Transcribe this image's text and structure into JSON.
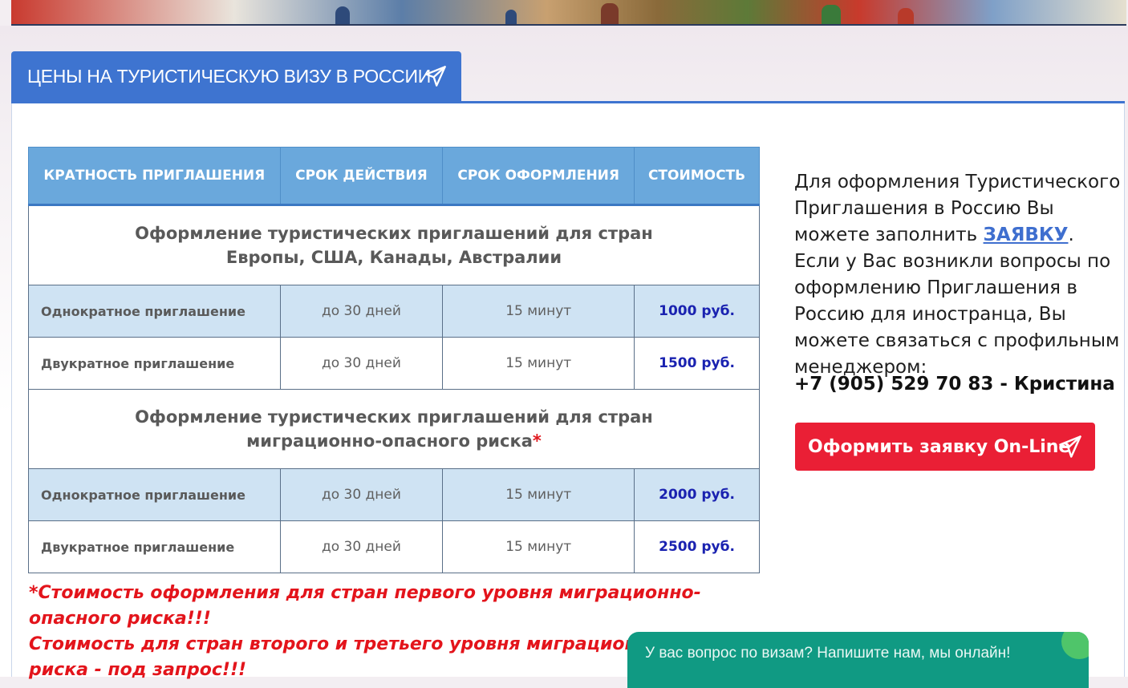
{
  "header": {
    "tab_title": "ЦЕНЫ НА ТУРИСТИЧЕСКУЮ ВИЗУ В РОССИИ"
  },
  "table": {
    "columns": [
      "КРАТНОСТЬ ПРИГЛАШЕНИЯ",
      "СРОК ДЕЙСТВИЯ",
      "СРОК ОФОРМЛЕНИЯ",
      "СТОИМОСТЬ"
    ],
    "section1": {
      "line1": "Оформление туристических приглашений для стран",
      "line2": "Европы, США, Канады, Австралии"
    },
    "section2": {
      "line1": "Оформление туристических приглашений для стран",
      "line2": "миграционно-опасного риска",
      "star": "*"
    },
    "rows1": [
      {
        "type": "Однократное приглашение",
        "validity": "до 30 дней",
        "processing": "15 минут",
        "price": "1000 руб."
      },
      {
        "type": "Двукратное приглашение",
        "validity": "до 30 дней",
        "processing": "15 минут",
        "price": "1500 руб."
      }
    ],
    "rows2": [
      {
        "type": "Однократное приглашение",
        "validity": "до 30 дней",
        "processing": "15 минут",
        "price": "2000 руб."
      },
      {
        "type": "Двукратное приглашение",
        "validity": "до 30 дней",
        "processing": "15 минут",
        "price": "2500 руб."
      }
    ]
  },
  "note": {
    "line1": "*Стоимость оформления для стран первого уровня миграционно-опасного риска!!!",
    "line2": "Стоимость для стран второго и третьего уровня миграционно-опасного риска - под запрос!!!"
  },
  "sidebar": {
    "text_before": "Для оформления Туристического Приглашения в Россию Вы можете заполнить ",
    "link": "ЗАЯВКУ",
    "text_after": ". Если у Вас возникли вопросы по оформлению Приглашения в Россию для иностранца, Вы можете связаться с профильным менеджером:",
    "phone": "+7 (905) 529 70 83 - Кристина",
    "order_button": "Оформить заявку On-Line"
  },
  "chat": {
    "text": "У вас вопрос по визам? Напишите нам, мы онлайн!"
  },
  "colors": {
    "accent_blue": "#3e74d0",
    "header_cell": "#6aa8dc",
    "row_shade": "#cfe3f3",
    "price_blue": "#1a22b0",
    "alert_red": "#e3141b",
    "button_red": "#ea1f35",
    "chat_green": "#109a83"
  },
  "icons": {
    "tab_icon": "paper-plane-icon",
    "button_icon": "paper-plane-icon"
  }
}
